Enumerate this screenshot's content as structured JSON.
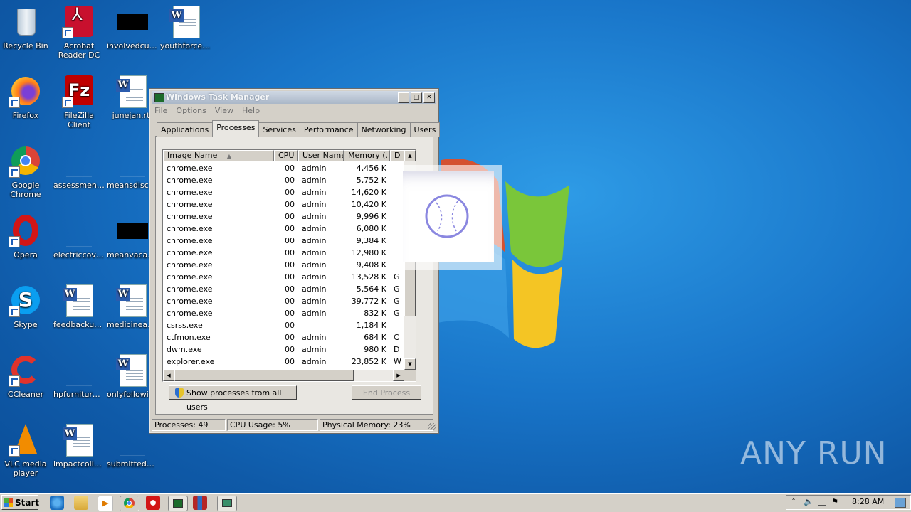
{
  "desktop": {
    "icons": [
      {
        "label": "Recycle Bin",
        "type": "recycle"
      },
      {
        "label": "Acrobat Reader DC",
        "type": "acrobat"
      },
      {
        "label": "involvedcurr...",
        "type": "black"
      },
      {
        "label": "youthforce.rtf",
        "type": "word"
      },
      {
        "label": "Firefox",
        "type": "firefox"
      },
      {
        "label": "FileZilla Client",
        "type": "filezilla"
      },
      {
        "label": "junejan.rtf",
        "type": "word"
      },
      {
        "label": "Google Chrome",
        "type": "chrome"
      },
      {
        "label": "assessment...",
        "type": "blank"
      },
      {
        "label": "meansdisco...",
        "type": "blank"
      },
      {
        "label": "Opera",
        "type": "opera"
      },
      {
        "label": "electriccove...",
        "type": "blank"
      },
      {
        "label": "meanvacati...",
        "type": "black"
      },
      {
        "label": "Skype",
        "type": "skype"
      },
      {
        "label": "feedbackup...",
        "type": "word"
      },
      {
        "label": "medicineac...",
        "type": "word"
      },
      {
        "label": "CCleaner",
        "type": "ccleaner"
      },
      {
        "label": "hpfurniture....",
        "type": "blank"
      },
      {
        "label": "onlyfollowin...",
        "type": "word"
      },
      {
        "label": "VLC media player",
        "type": "vlc"
      },
      {
        "label": "impactcollect...",
        "type": "word"
      },
      {
        "label": "submittedb...",
        "type": "blank"
      }
    ],
    "watermark": "ANY RUN"
  },
  "task_manager": {
    "title": "Windows Task Manager",
    "menu": [
      "File",
      "Options",
      "View",
      "Help"
    ],
    "tabs": [
      "Applications",
      "Processes",
      "Services",
      "Performance",
      "Networking",
      "Users"
    ],
    "active_tab": "Processes",
    "columns": [
      "Image Name",
      "CPU",
      "User Name",
      "Memory (...",
      "D"
    ],
    "rows": [
      [
        "chrome.exe",
        "00",
        "admin",
        "4,456 K",
        ""
      ],
      [
        "chrome.exe",
        "00",
        "admin",
        "5,752 K",
        ""
      ],
      [
        "chrome.exe",
        "00",
        "admin",
        "14,620 K",
        ""
      ],
      [
        "chrome.exe",
        "00",
        "admin",
        "10,420 K",
        ""
      ],
      [
        "chrome.exe",
        "00",
        "admin",
        "9,996 K",
        ""
      ],
      [
        "chrome.exe",
        "00",
        "admin",
        "6,080 K",
        ""
      ],
      [
        "chrome.exe",
        "00",
        "admin",
        "9,384 K",
        ""
      ],
      [
        "chrome.exe",
        "00",
        "admin",
        "12,980 K",
        ""
      ],
      [
        "chrome.exe",
        "00",
        "admin",
        "9,408 K",
        ""
      ],
      [
        "chrome.exe",
        "00",
        "admin",
        "13,528 K",
        "G"
      ],
      [
        "chrome.exe",
        "00",
        "admin",
        "5,564 K",
        "G"
      ],
      [
        "chrome.exe",
        "00",
        "admin",
        "39,772 K",
        "G"
      ],
      [
        "chrome.exe",
        "00",
        "admin",
        "832 K",
        "G"
      ],
      [
        "csrss.exe",
        "00",
        "",
        "1,184 K",
        ""
      ],
      [
        "ctfmon.exe",
        "00",
        "admin",
        "684 K",
        "C"
      ],
      [
        "dwm.exe",
        "00",
        "admin",
        "980 K",
        "D"
      ],
      [
        "explorer.exe",
        "00",
        "admin",
        "23,852 K",
        "W"
      ]
    ],
    "show_all_button": "Show processes from all users",
    "end_process_button": "End Process",
    "status": {
      "processes": "Processes: 49",
      "cpu": "CPU Usage: 5%",
      "memory": "Physical Memory: 23%"
    }
  },
  "taskbar": {
    "start_label": "Start",
    "clock": "8:28 AM"
  }
}
